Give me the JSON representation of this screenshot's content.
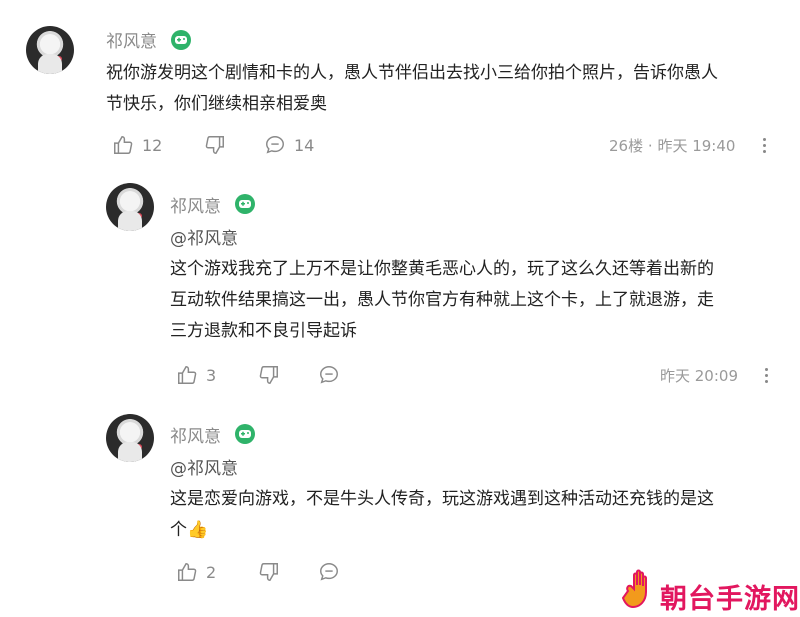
{
  "comments": [
    {
      "author": "祁风意",
      "mention": "",
      "text_lines": [
        "祝你游发明这个剧情和卡的人，愚人节伴侣出去找小三给你拍个照片，告诉你愚人",
        "节快乐，你们继续相亲相爱奥"
      ],
      "likes": "12",
      "replies": "14",
      "floor": "26楼",
      "sep": "·",
      "time": "昨天 19:40"
    },
    {
      "author": "祁风意",
      "mention": "@祁风意",
      "text_lines": [
        "这个游戏我充了上万不是让你整黄毛恶心人的，玩了这么久还等着出新的",
        "互动软件结果搞这一出，愚人节你官方有种就上这个卡，上了就退游，走",
        "三方退款和不良引导起诉"
      ],
      "likes": "3",
      "time": "昨天 20:09"
    },
    {
      "author": "祁风意",
      "mention": "@祁风意",
      "text_lines": [
        "这是恋爱向游戏，不是牛头人传奇，玩这游戏遇到这种活动还充钱的是这",
        "个"
      ],
      "emoji": "👍",
      "likes": "2"
    }
  ],
  "icons": {
    "like": "thumbs-up-icon",
    "dislike": "thumbs-down-icon",
    "reply": "comment-bubble-icon",
    "more": "more-vertical-icon",
    "badge": "gamepad-badge-icon"
  },
  "colors": {
    "badge_green": "#2fb36a",
    "muted": "#8a8a8a",
    "watermark": "#e2175f"
  },
  "watermark": {
    "text": "朝台手游网"
  }
}
